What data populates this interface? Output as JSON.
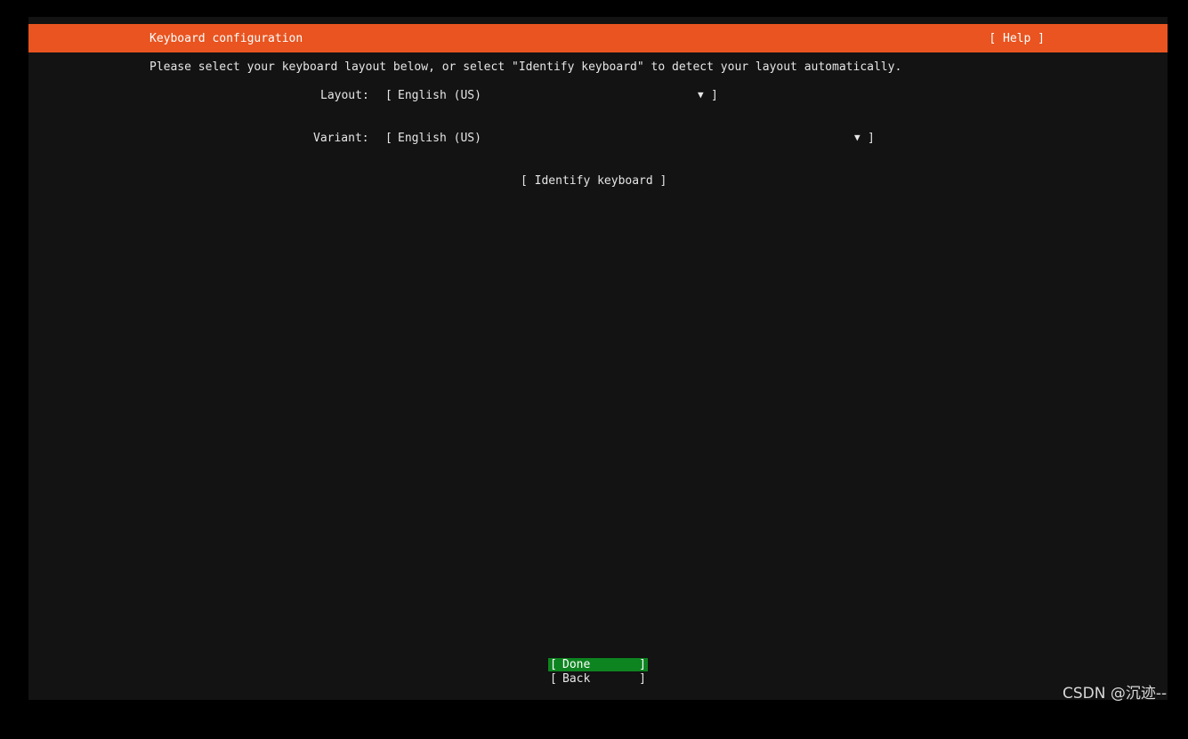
{
  "header": {
    "title": "Keyboard configuration",
    "help_label": "[ Help ]"
  },
  "main": {
    "instructions": "Please select your keyboard layout below, or select \"Identify keyboard\" to detect your layout automatically.",
    "layout": {
      "label": "Layout:",
      "value": "English (US)"
    },
    "variant": {
      "label": "Variant:",
      "value": "English (US)"
    },
    "identify_label": "[ Identify keyboard ]",
    "open_bracket": "[",
    "close_bracket": "]",
    "dropdown_glyph": "▼"
  },
  "footer": {
    "done_label": "Done",
    "back_label": "Back"
  },
  "watermark": "CSDN @沉迹--",
  "colors": {
    "header": "#e95420",
    "background": "#131313",
    "selected_button": "#0e8420",
    "text": "#e6e6e6"
  }
}
